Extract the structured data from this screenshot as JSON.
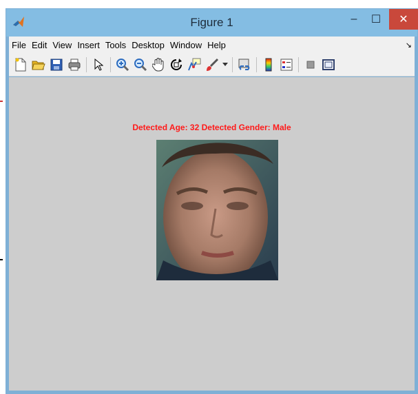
{
  "window": {
    "title": "Figure 1",
    "controls": {
      "minimize": "–",
      "maximize": "☐",
      "close": "✕"
    }
  },
  "menu": {
    "items": [
      "File",
      "Edit",
      "View",
      "Insert",
      "Tools",
      "Desktop",
      "Window",
      "Help"
    ],
    "overflow": "↘"
  },
  "toolbar": {
    "icons": [
      "new-figure-icon",
      "open-file-icon",
      "save-icon",
      "print-icon",
      "pointer-arrow-icon",
      "zoom-in-icon",
      "zoom-out-icon",
      "pan-hand-icon",
      "rotate-3d-icon",
      "data-cursor-icon",
      "brush-icon",
      "link-plot-icon",
      "colorbar-icon",
      "legend-icon",
      "hide-plot-tools-icon",
      "show-plot-tools-icon"
    ]
  },
  "figure": {
    "caption": "Detected Age: 32 Detected Gender: Male",
    "image": "face-photo"
  },
  "colors": {
    "titlebar": "#84bde3",
    "close_button": "#c9483b",
    "canvas": "#cdcdcd",
    "caption": "#ff1a1a"
  }
}
